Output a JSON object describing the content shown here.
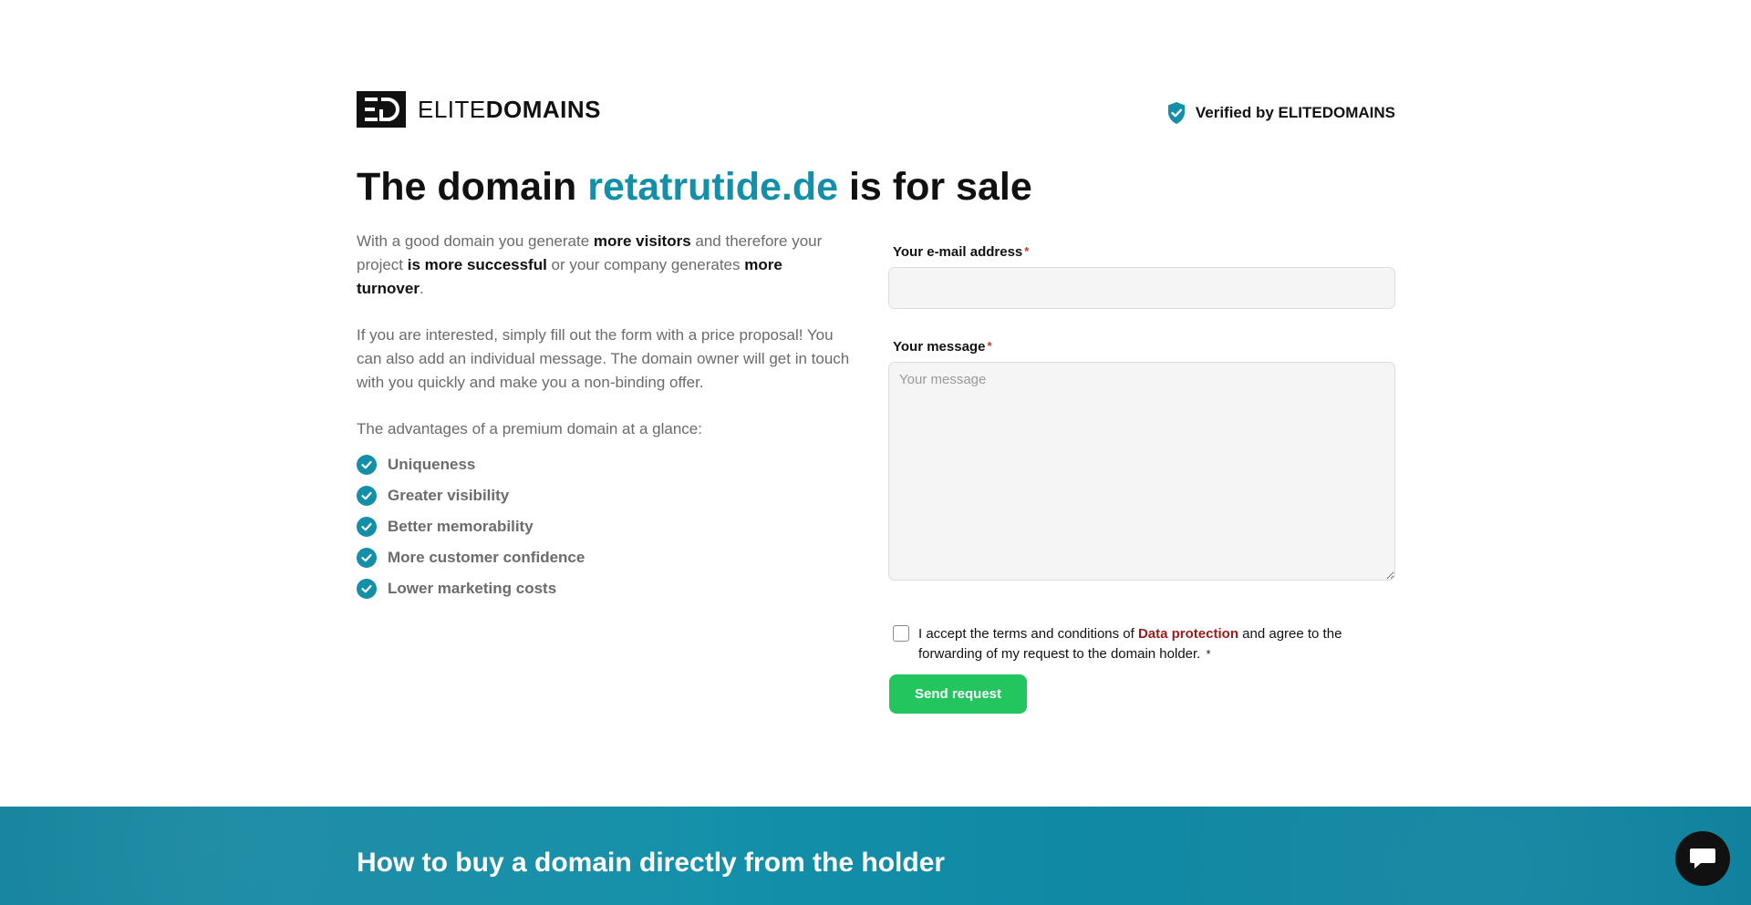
{
  "header": {
    "logo_mark": "ED",
    "logo_text_light": "ELITE",
    "logo_text_bold": "DOMAINS",
    "verified_label": "Verified by ELITEDOMAINS"
  },
  "hero": {
    "title_prefix": "The domain ",
    "domain": "retatrutide.de",
    "title_suffix": " is for sale"
  },
  "intro": {
    "p1_a": "With a good domain you generate ",
    "p1_b": "more visitors",
    "p1_c": " and therefore your project ",
    "p1_d": "is more successful",
    "p1_e": " or your company generates ",
    "p1_f": "more turnover",
    "p1_g": ".",
    "p2": "If you are interested, simply fill out the form with a price proposal! You can also add an individual message. The domain owner will get in touch with you quickly and make you a non-binding offer.",
    "advantages_title": "The advantages of a premium domain at a glance:",
    "benefits": [
      "Uniqueness",
      "Greater visibility",
      "Better memorability",
      "More customer confidence",
      "Lower marketing costs"
    ]
  },
  "form": {
    "email_label": "Your e-mail address",
    "email_value": "",
    "message_label": "Your message",
    "message_placeholder": "Your message",
    "required_mark": "*",
    "accept_a": "I accept the terms and conditions of ",
    "accept_link": "Data protection",
    "accept_b": " and agree to the forwarding of my request to the domain holder.",
    "submit_label": "Send request"
  },
  "banner": {
    "title": "How to buy a domain directly from the holder"
  },
  "icons": {
    "verified": "shield-check-icon",
    "benefit": "check-circle-icon",
    "chat": "chat-bubble-icon"
  },
  "colors": {
    "accent": "#1390a8",
    "button": "#22c55e",
    "link": "#9b1c1c",
    "banner": "#0e86a2"
  }
}
